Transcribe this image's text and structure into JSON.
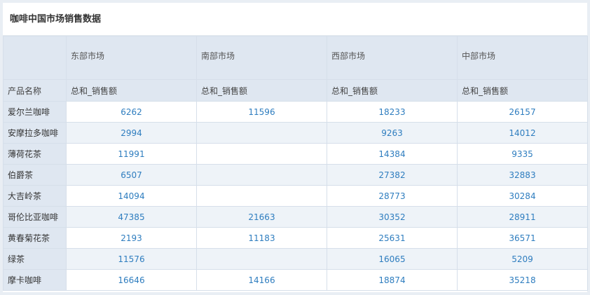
{
  "title": "咖啡中国市场销售数据",
  "table": {
    "markets": [
      "东部市场",
      "南部市场",
      "西部市场",
      "中部市场"
    ],
    "row_header_label": "产品名称",
    "measure_label": "总和_销售额",
    "rows": [
      {
        "name": "爱尔兰咖啡",
        "values": [
          "6262",
          "11596",
          "18233",
          "26157"
        ]
      },
      {
        "name": "安摩拉多咖啡",
        "values": [
          "2994",
          "",
          "9263",
          "14012"
        ]
      },
      {
        "name": "薄荷花茶",
        "values": [
          "11991",
          "",
          "14384",
          "9335"
        ]
      },
      {
        "name": "伯爵茶",
        "values": [
          "6507",
          "",
          "27382",
          "32883"
        ]
      },
      {
        "name": "大吉岭茶",
        "values": [
          "14094",
          "",
          "28773",
          "30284"
        ]
      },
      {
        "name": "哥伦比亚咖啡",
        "values": [
          "47385",
          "21663",
          "30352",
          "28911"
        ]
      },
      {
        "name": "黄春菊花茶",
        "values": [
          "2193",
          "11183",
          "25631",
          "36571"
        ]
      },
      {
        "name": "绿茶",
        "values": [
          "11576",
          "",
          "16065",
          "5209"
        ]
      },
      {
        "name": "摩卡咖啡",
        "values": [
          "16646",
          "14166",
          "18874",
          "35218"
        ]
      }
    ]
  },
  "colors": {
    "header_bg": "#dfe7f1",
    "value_text": "#2e7dbf",
    "stripe": "#eef3f8",
    "border": "#d6dfea"
  }
}
